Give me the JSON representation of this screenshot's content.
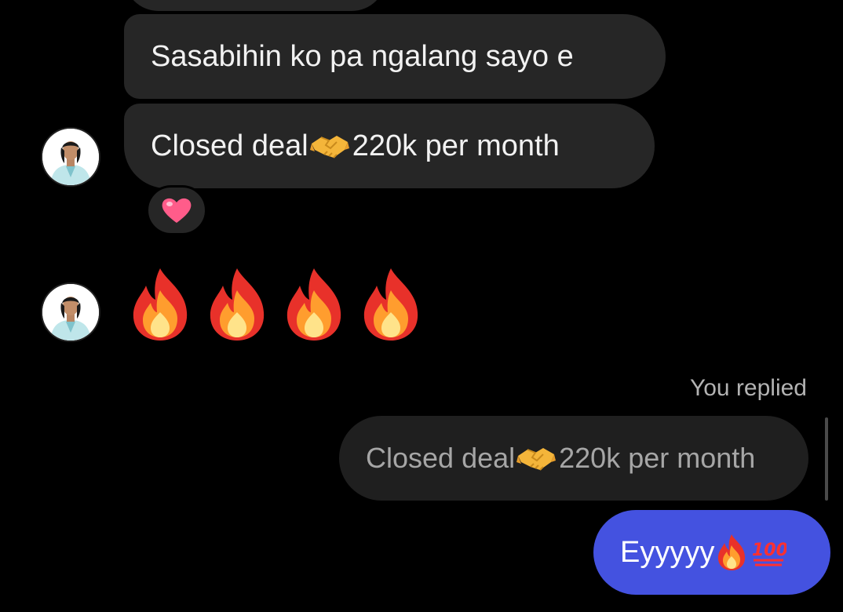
{
  "chat": {
    "messages": {
      "m1_text": "Sasabihin ko pa ngalang sayo e",
      "m2_text_a": "Closed deal",
      "m2_text_b": " 220k per month",
      "m2_icon": "handshake-emoji",
      "reaction_icon": "pink-heart-emoji",
      "fire_icons": [
        "fire-emoji",
        "fire-emoji",
        "fire-emoji",
        "fire-emoji"
      ]
    },
    "reply": {
      "label": "You replied",
      "quoted_text_a": "Closed deal",
      "quoted_text_b": " 220k per month",
      "sent_text": "Eyyyyy",
      "sent_icons": [
        "fire-emoji",
        "hundred-points-emoji"
      ]
    }
  },
  "colors": {
    "background": "#000000",
    "received_bubble": "#262626",
    "sent_bubble": "#4452e0",
    "muted_text": "#a6a6a6"
  }
}
